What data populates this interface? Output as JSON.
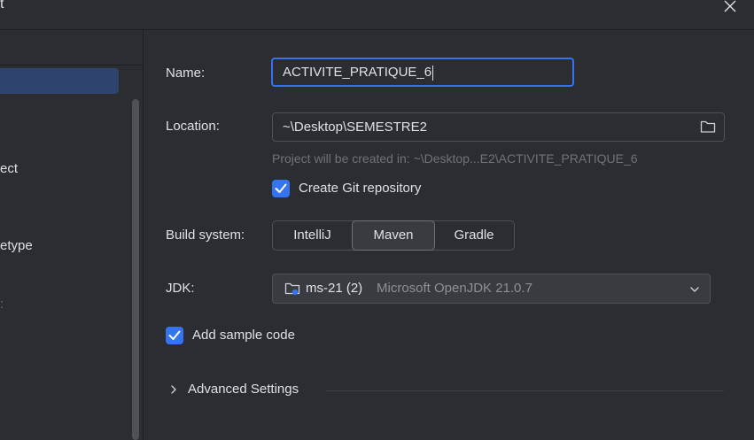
{
  "window": {
    "title_fragment": "t"
  },
  "sidebar": {
    "items": [
      {
        "label": "ect"
      },
      {
        "label": "etype"
      },
      {
        "label": ":"
      }
    ]
  },
  "form": {
    "name_label": "Name:",
    "name_value": "ACTIVITE_PRATIQUE_6",
    "location_label": "Location:",
    "location_value": "~\\Desktop\\SEMESTRE2",
    "location_hint": "Project will be created in: ~\\Desktop...E2\\ACTIVITE_PRATIQUE_6",
    "create_git_label": "Create Git repository",
    "create_git_checked": true,
    "build_system_label": "Build system:",
    "build_options": [
      "IntelliJ",
      "Maven",
      "Gradle"
    ],
    "build_selected": "Maven",
    "jdk_label": "JDK:",
    "jdk_name": "ms-21 (2)",
    "jdk_version": "Microsoft OpenJDK 21.0.7",
    "sample_code_label": "Add sample code",
    "sample_code_checked": true,
    "advanced_label": "Advanced Settings"
  },
  "icons": {
    "close": "close-icon",
    "folder": "folder-icon",
    "checkbox": "checkmark-icon",
    "jdk": "jdk-folder-icon",
    "dropdown": "chevron-down-icon",
    "expand": "chevron-right-icon"
  },
  "colors": {
    "background": "#2b2d30",
    "accent": "#3574f0",
    "selection": "#2e436e",
    "muted_text": "#6f737a"
  }
}
